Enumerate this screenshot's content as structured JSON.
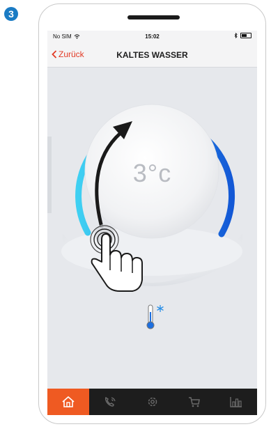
{
  "step": {
    "number": "3"
  },
  "status_bar": {
    "carrier": "No SIM",
    "time": "15:02"
  },
  "nav": {
    "back_label": "Zurück",
    "title": "KALTES WASSER"
  },
  "dial": {
    "temperature": "3°c"
  },
  "tabs": [
    {
      "icon": "home-icon",
      "active": true
    },
    {
      "icon": "phone-icon",
      "active": false
    },
    {
      "icon": "gear-icon",
      "active": false
    },
    {
      "icon": "cart-icon",
      "active": false
    },
    {
      "icon": "bar-chart-icon",
      "active": false
    }
  ],
  "colors": {
    "accent": "#ef5a22",
    "back": "#e23a25",
    "dial_blue": "#1d6fe0",
    "dial_cyan": "#35c7ee",
    "step": "#1a7bc4"
  }
}
